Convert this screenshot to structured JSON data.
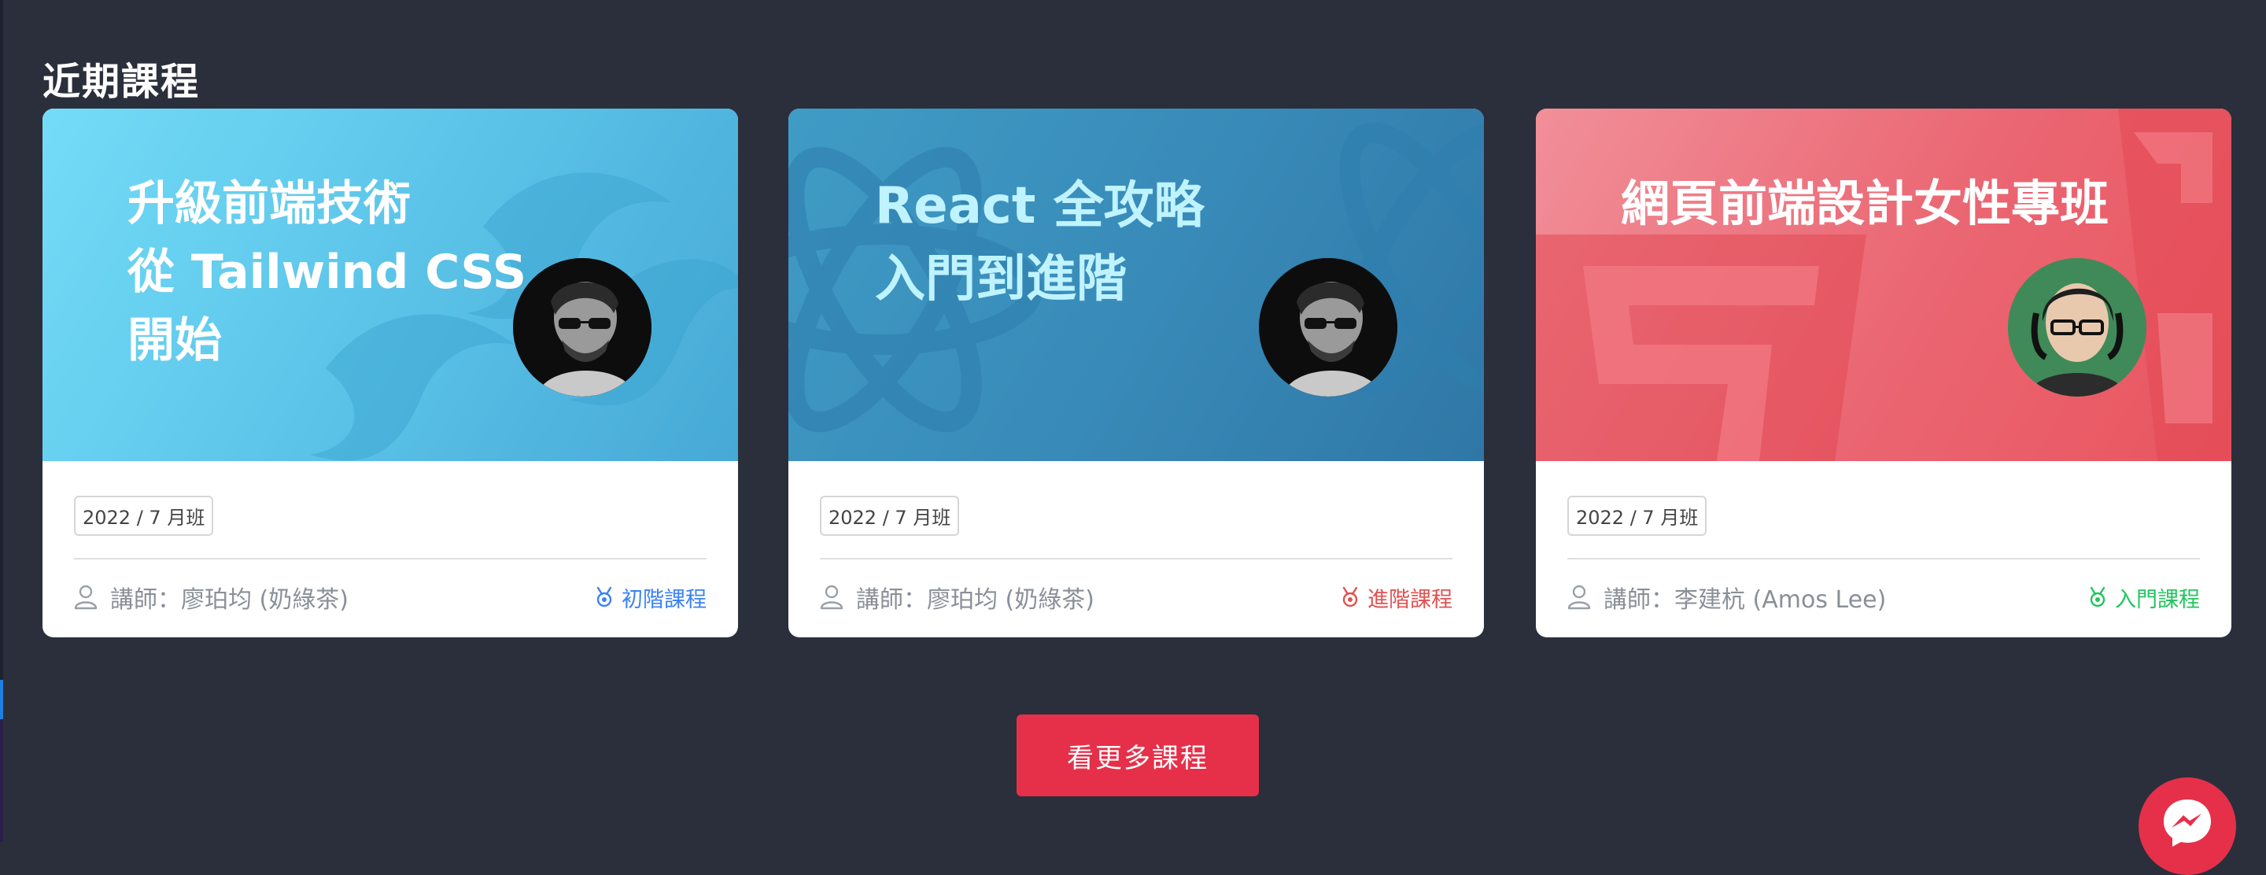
{
  "section": {
    "title": "近期課程"
  },
  "colors": {
    "background": "#2b2f3c",
    "beginner": "#3b82f6",
    "advanced": "#e05252",
    "intro": "#22c55e",
    "cta": "#e6304a"
  },
  "courses": [
    {
      "banner_title": "升級前端技術\n從 Tailwind CSS\n開始",
      "batch": "2022 / 7 月班",
      "teacher": "講師：廖珀均 (奶綠茶)",
      "level": "初階課程",
      "level_color": "#3b82f6",
      "icons": [
        "user-icon",
        "medal-icon"
      ]
    },
    {
      "banner_title": "React 全攻略\n入門到進階",
      "batch": "2022 / 7 月班",
      "teacher": "講師：廖珀均 (奶綠茶)",
      "level": "進階課程",
      "level_color": "#e05252",
      "icons": [
        "user-icon",
        "medal-icon"
      ]
    },
    {
      "banner_title": "網頁前端設計女性專班",
      "batch": "2022 / 7 月班",
      "teacher": "講師：李建杭 (Amos Lee)",
      "level": "入門課程",
      "level_color": "#22c55e",
      "icons": [
        "user-icon",
        "medal-icon"
      ]
    }
  ],
  "more_button": {
    "label": "看更多課程"
  },
  "chat": {
    "icon": "messenger-icon"
  }
}
